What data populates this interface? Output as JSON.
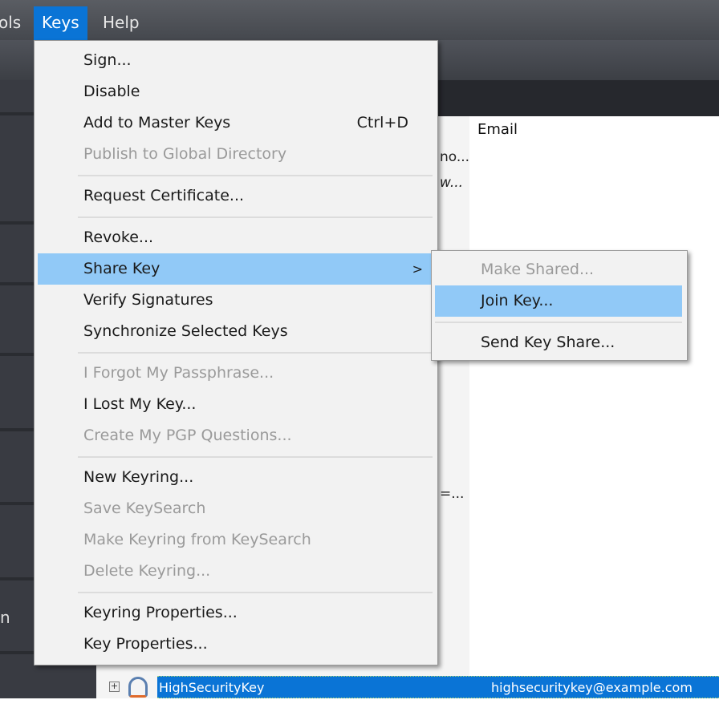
{
  "menubar": {
    "items": [
      "ols",
      "Keys",
      "Help"
    ]
  },
  "menu": {
    "items": [
      {
        "label": "Sign...",
        "state": "enabled"
      },
      {
        "label": "Disable",
        "state": "enabled"
      },
      {
        "label": "Add to Master Keys",
        "shortcut": "Ctrl+D",
        "state": "enabled"
      },
      {
        "label": "Publish to Global Directory",
        "state": "disabled"
      },
      {
        "label": "Request Certificate...",
        "state": "enabled"
      },
      {
        "label": "Revoke...",
        "state": "enabled"
      },
      {
        "label": "Share Key",
        "state": "highlighted"
      },
      {
        "label": "Verify Signatures",
        "state": "enabled"
      },
      {
        "label": "Synchronize Selected Keys",
        "state": "enabled"
      },
      {
        "label": "I Forgot My Passphrase...",
        "state": "disabled"
      },
      {
        "label": "I Lost My Key...",
        "state": "enabled"
      },
      {
        "label": "Create My PGP Questions...",
        "state": "disabled"
      },
      {
        "label": "New Keyring...",
        "state": "enabled"
      },
      {
        "label": "Save KeySearch",
        "state": "disabled"
      },
      {
        "label": "Make Keyring from KeySearch",
        "state": "disabled"
      },
      {
        "label": "Delete Keyring...",
        "state": "disabled"
      },
      {
        "label": "Keyring Properties...",
        "state": "enabled"
      },
      {
        "label": "Key Properties...",
        "state": "enabled"
      }
    ]
  },
  "submenu": {
    "items": [
      {
        "label": "Make Shared...",
        "state": "disabled"
      },
      {
        "label": "Join Key...",
        "state": "highlighted"
      },
      {
        "label": "Send Key Share...",
        "state": "enabled"
      }
    ]
  },
  "sidebar": {
    "partial_label": "n"
  },
  "table": {
    "email_header": "Email",
    "truncated": [
      "no...",
      "w...",
      "=..."
    ],
    "selected_row": {
      "name": "HighSecurityKey",
      "email": "highsecuritykey@example.com"
    }
  },
  "colors": {
    "highlight": "#91c9f7",
    "selection": "#0a74d6",
    "menubar_active": "#0a74d6"
  }
}
